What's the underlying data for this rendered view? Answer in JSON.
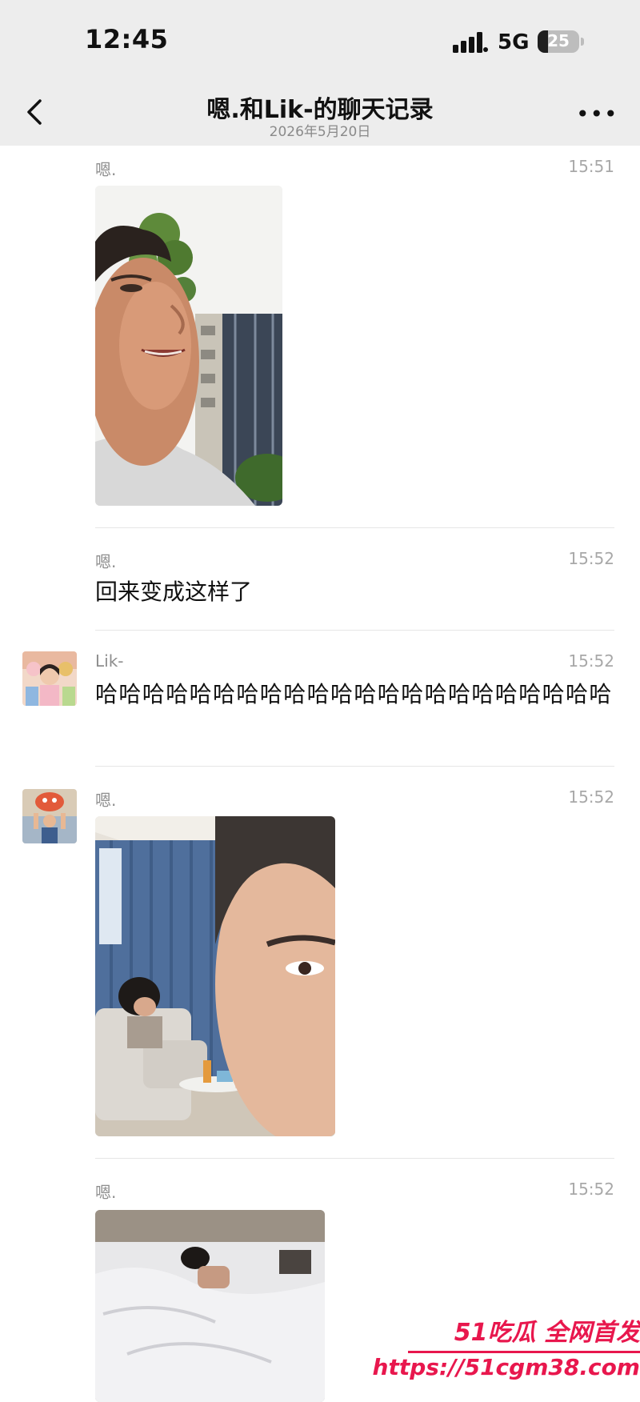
{
  "status_bar": {
    "time": "12:45",
    "network": "5G",
    "battery_level": "25",
    "battery_percent": 25
  },
  "nav": {
    "title": "嗯.和Lik-的聊天记录",
    "subtitle": "2026年5月20日"
  },
  "messages": [
    {
      "sender": "嗯.",
      "time": "15:51",
      "type": "image"
    },
    {
      "sender": "嗯.",
      "time": "15:52",
      "type": "text",
      "text": "回来变成这样了"
    },
    {
      "sender": "Lik-",
      "time": "15:52",
      "type": "text",
      "text": "哈哈哈哈哈哈哈哈哈哈哈哈哈哈哈哈哈哈哈哈哈哈"
    },
    {
      "sender": "嗯.",
      "time": "15:52",
      "type": "image"
    },
    {
      "sender": "嗯.",
      "time": "15:52",
      "type": "image"
    }
  ],
  "watermark": {
    "brand": "51吃瓜 全网首发",
    "url": "https://51cgm38.com"
  },
  "colors": {
    "bar_background": "#ededed",
    "watermark": "#e8174d"
  }
}
